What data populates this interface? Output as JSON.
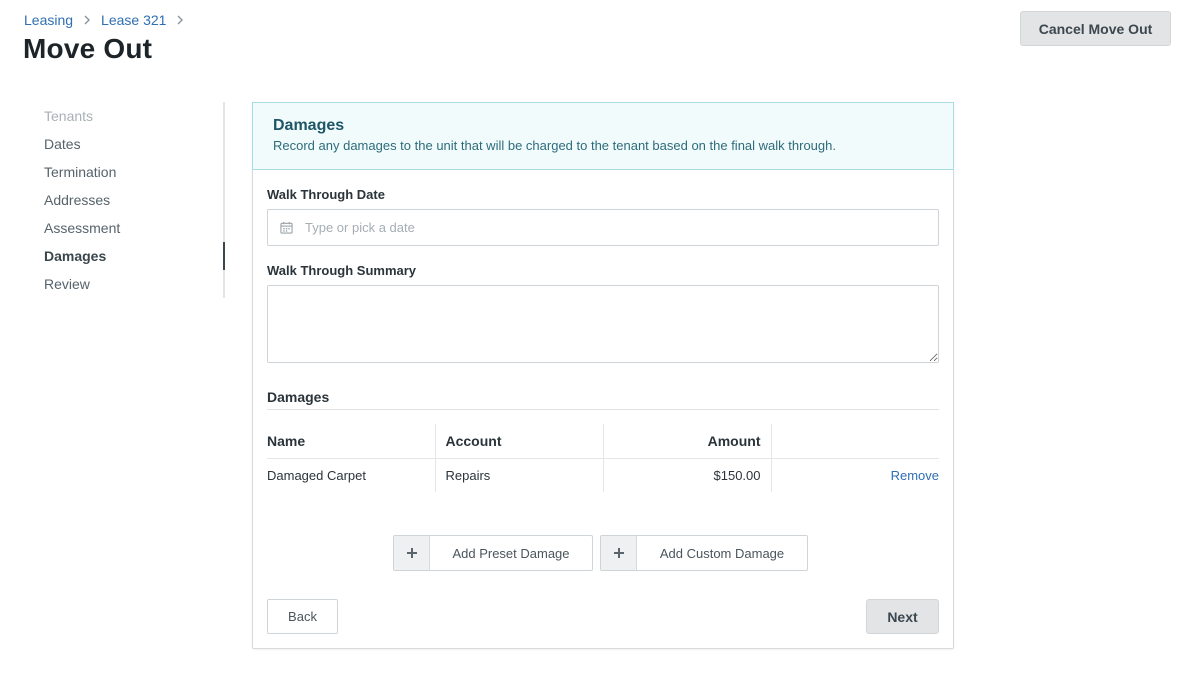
{
  "breadcrumb": {
    "items": [
      "Leasing",
      "Lease 321"
    ]
  },
  "page": {
    "title": "Move Out",
    "cancel_label": "Cancel Move Out"
  },
  "sidenav": {
    "items": [
      {
        "label": "Tenants",
        "state": "disabled"
      },
      {
        "label": "Dates",
        "state": "normal"
      },
      {
        "label": "Termination",
        "state": "normal"
      },
      {
        "label": "Addresses",
        "state": "normal"
      },
      {
        "label": "Assessment",
        "state": "normal"
      },
      {
        "label": "Damages",
        "state": "active"
      },
      {
        "label": "Review",
        "state": "normal"
      }
    ]
  },
  "panel": {
    "title": "Damages",
    "description": "Record any damages to the unit that will be charged to the tenant based on the final walk through.",
    "walk_through_date": {
      "label": "Walk Through Date",
      "value": "",
      "placeholder": "Type or pick a date"
    },
    "walk_through_summary": {
      "label": "Walk Through Summary",
      "value": ""
    },
    "damages": {
      "title": "Damages",
      "columns": [
        "Name",
        "Account",
        "Amount"
      ],
      "rows": [
        {
          "name": "Damaged Carpet",
          "account": "Repairs",
          "amount": "$150.00",
          "action": "Remove"
        }
      ]
    },
    "add_preset_label": "Add Preset Damage",
    "add_custom_label": "Add Custom Damage",
    "back_label": "Back",
    "next_label": "Next"
  },
  "colors": {
    "link": "#2f6fb3",
    "header_bg": "#f1fbfc",
    "header_title": "#1f5667",
    "button_gray": "#e2e4e6"
  }
}
